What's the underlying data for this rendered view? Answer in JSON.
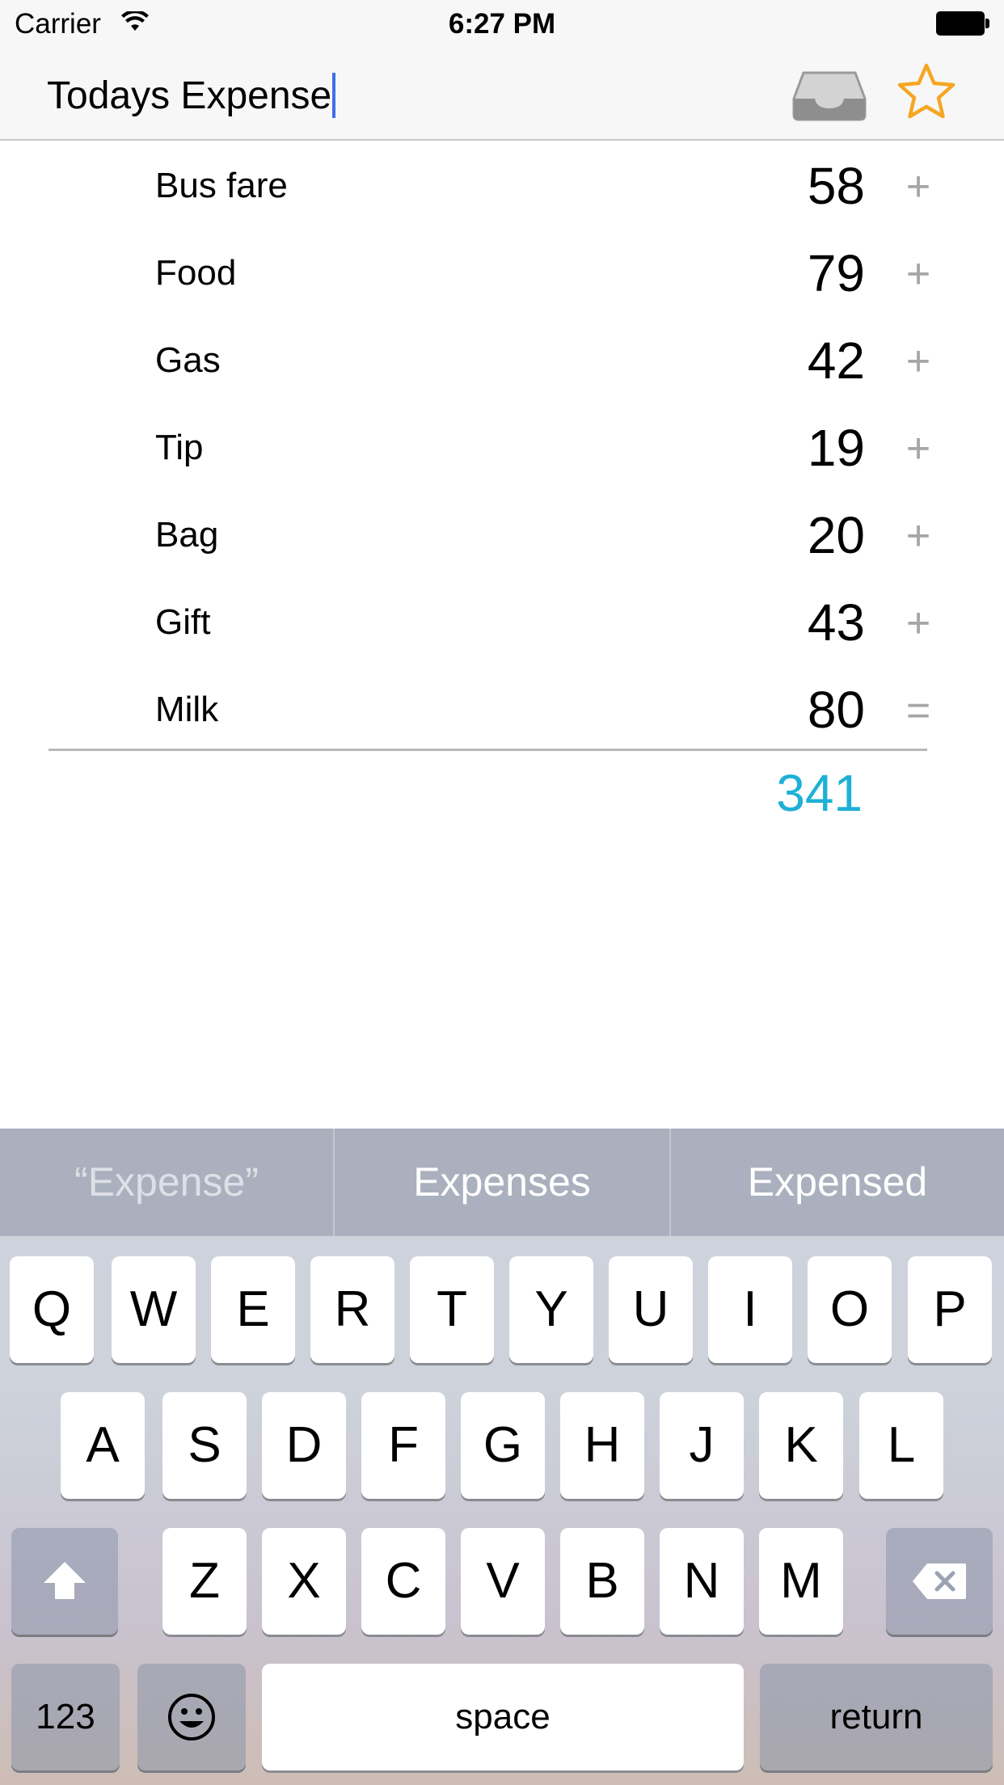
{
  "status_bar": {
    "carrier": "Carrier",
    "time": "6:27 PM"
  },
  "header": {
    "title": "Todays Expense",
    "inbox_icon": "inbox-tray-icon",
    "star_icon": "star-icon",
    "star_color": "#f5a623"
  },
  "expenses": [
    {
      "label": "Bus fare",
      "amount": "58",
      "op": "+"
    },
    {
      "label": "Food",
      "amount": "79",
      "op": "+"
    },
    {
      "label": "Gas",
      "amount": "42",
      "op": "+"
    },
    {
      "label": "Tip",
      "amount": "19",
      "op": "+"
    },
    {
      "label": "Bag",
      "amount": "20",
      "op": "+"
    },
    {
      "label": "Gift",
      "amount": "43",
      "op": "+"
    },
    {
      "label": "Milk",
      "amount": "80",
      "op": "="
    }
  ],
  "total": "341",
  "total_color": "#1eb0d6",
  "keyboard": {
    "suggestions": [
      "“Expense”",
      "Expenses",
      "Expensed"
    ],
    "row1": [
      "Q",
      "W",
      "E",
      "R",
      "T",
      "Y",
      "U",
      "I",
      "O",
      "P"
    ],
    "row2": [
      "A",
      "S",
      "D",
      "F",
      "G",
      "H",
      "J",
      "K",
      "L"
    ],
    "row3": [
      "Z",
      "X",
      "C",
      "V",
      "B",
      "N",
      "M"
    ],
    "numbers": "123",
    "space": "space",
    "return": "return"
  }
}
